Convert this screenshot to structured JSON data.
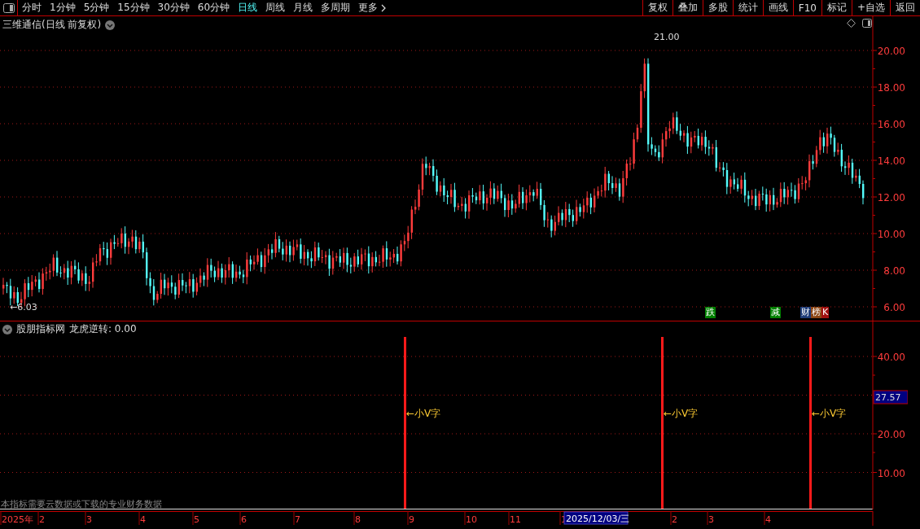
{
  "toolbar": {
    "periods": [
      {
        "label": "分时",
        "selected": false
      },
      {
        "label": "1分钟",
        "selected": false
      },
      {
        "label": "5分钟",
        "selected": false
      },
      {
        "label": "15分钟",
        "selected": false
      },
      {
        "label": "30分钟",
        "selected": false
      },
      {
        "label": "60分钟",
        "selected": false
      },
      {
        "label": "日线",
        "selected": true
      },
      {
        "label": "周线",
        "selected": false
      },
      {
        "label": "月线",
        "selected": false
      },
      {
        "label": "多周期",
        "selected": false
      },
      {
        "label": "更多",
        "selected": false
      }
    ],
    "buttons": [
      "复权",
      "叠加",
      "多股",
      "统计",
      "画线",
      "F10",
      "标记",
      "+自选",
      "返回"
    ]
  },
  "price_panel": {
    "title": "三维通信(日线 前复权)",
    "yticks": [
      "20.00",
      "18.00",
      "16.00",
      "14.00",
      "12.00",
      "10.00",
      "8.00",
      "6.00"
    ],
    "high_label": "21.00",
    "low_label": "←6.03",
    "markers": [
      {
        "label": "跌",
        "color": "#008000"
      },
      {
        "label": "减",
        "color": "#008000"
      },
      {
        "label": "财",
        "color": "#1e3c78"
      },
      {
        "label": "榜",
        "color": "#8b4513"
      },
      {
        "label": "K",
        "color": "#a01010"
      }
    ]
  },
  "indicator_panel": {
    "source": "股朋指标网",
    "indicator": "龙虎逆转: 0.00",
    "yticks": [
      "40.00",
      "20.00",
      "10.00"
    ],
    "current_value": "27.57",
    "signals": [
      {
        "label": "←小V字"
      },
      {
        "label": "←小V字"
      },
      {
        "label": "←小V字"
      }
    ],
    "notice": "本指标需要云数据或下载的专业财务数据"
  },
  "date_axis": {
    "labels": [
      "2025年",
      "2",
      "3",
      "4",
      "5",
      "6",
      "7",
      "8",
      "9",
      "10",
      "11",
      "1",
      "2",
      "3",
      "4"
    ],
    "cursor_date": "2025/12/03/三"
  }
}
